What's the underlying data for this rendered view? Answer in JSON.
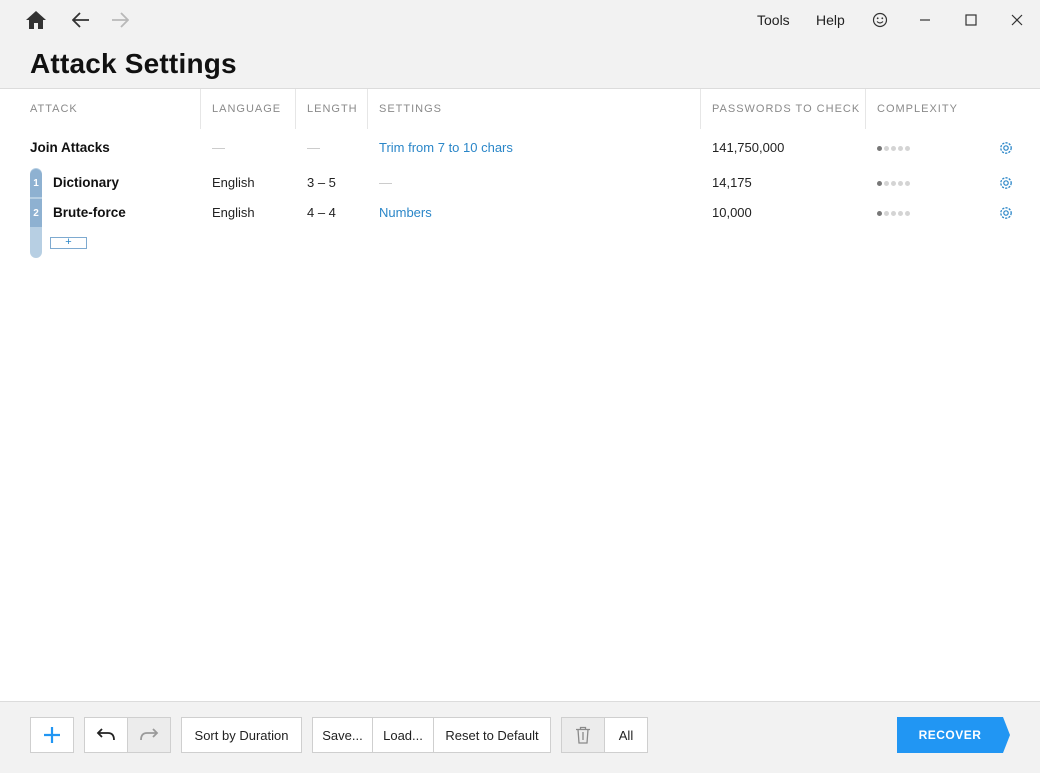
{
  "window": {
    "menu": {
      "tools": "Tools",
      "help": "Help"
    }
  },
  "page": {
    "title": "Attack Settings"
  },
  "table": {
    "columns": {
      "attack": "ATTACK",
      "language": "LANGUAGE",
      "length": "LENGTH",
      "settings": "SETTINGS",
      "passwords": "PASSWORDS TO CHECK",
      "complexity": "COMPLEXITY"
    },
    "rows": [
      {
        "name": "Join Attacks",
        "language": "—",
        "length": "—",
        "settings": "Trim from 7 to 10 chars",
        "passwords": "141,750,000",
        "complexity": 1
      },
      {
        "index": "1",
        "name": "Dictionary",
        "language": "English",
        "length": "3 – 5",
        "settings": "—",
        "passwords": "14,175",
        "complexity": 1
      },
      {
        "index": "2",
        "name": "Brute-force",
        "language": "English",
        "length": "4 – 4",
        "settings": "Numbers",
        "passwords": "10,000",
        "complexity": 1
      }
    ],
    "add_label": "+"
  },
  "footer": {
    "add": "+",
    "sort": "Sort by Duration",
    "save": "Save...",
    "load": "Load...",
    "reset": "Reset to Default",
    "all": "All",
    "recover": "RECOVER"
  },
  "colors": {
    "accent": "#2196f3",
    "link": "#2a86c8",
    "rail": "#b7cfe3",
    "badge": "#8eb1d1"
  },
  "icons": [
    "home-icon",
    "back-arrow-icon",
    "forward-arrow-icon",
    "smiley-icon",
    "minimize-icon",
    "maximize-icon",
    "close-icon",
    "gear-icon",
    "undo-icon",
    "redo-icon",
    "trash-icon"
  ]
}
